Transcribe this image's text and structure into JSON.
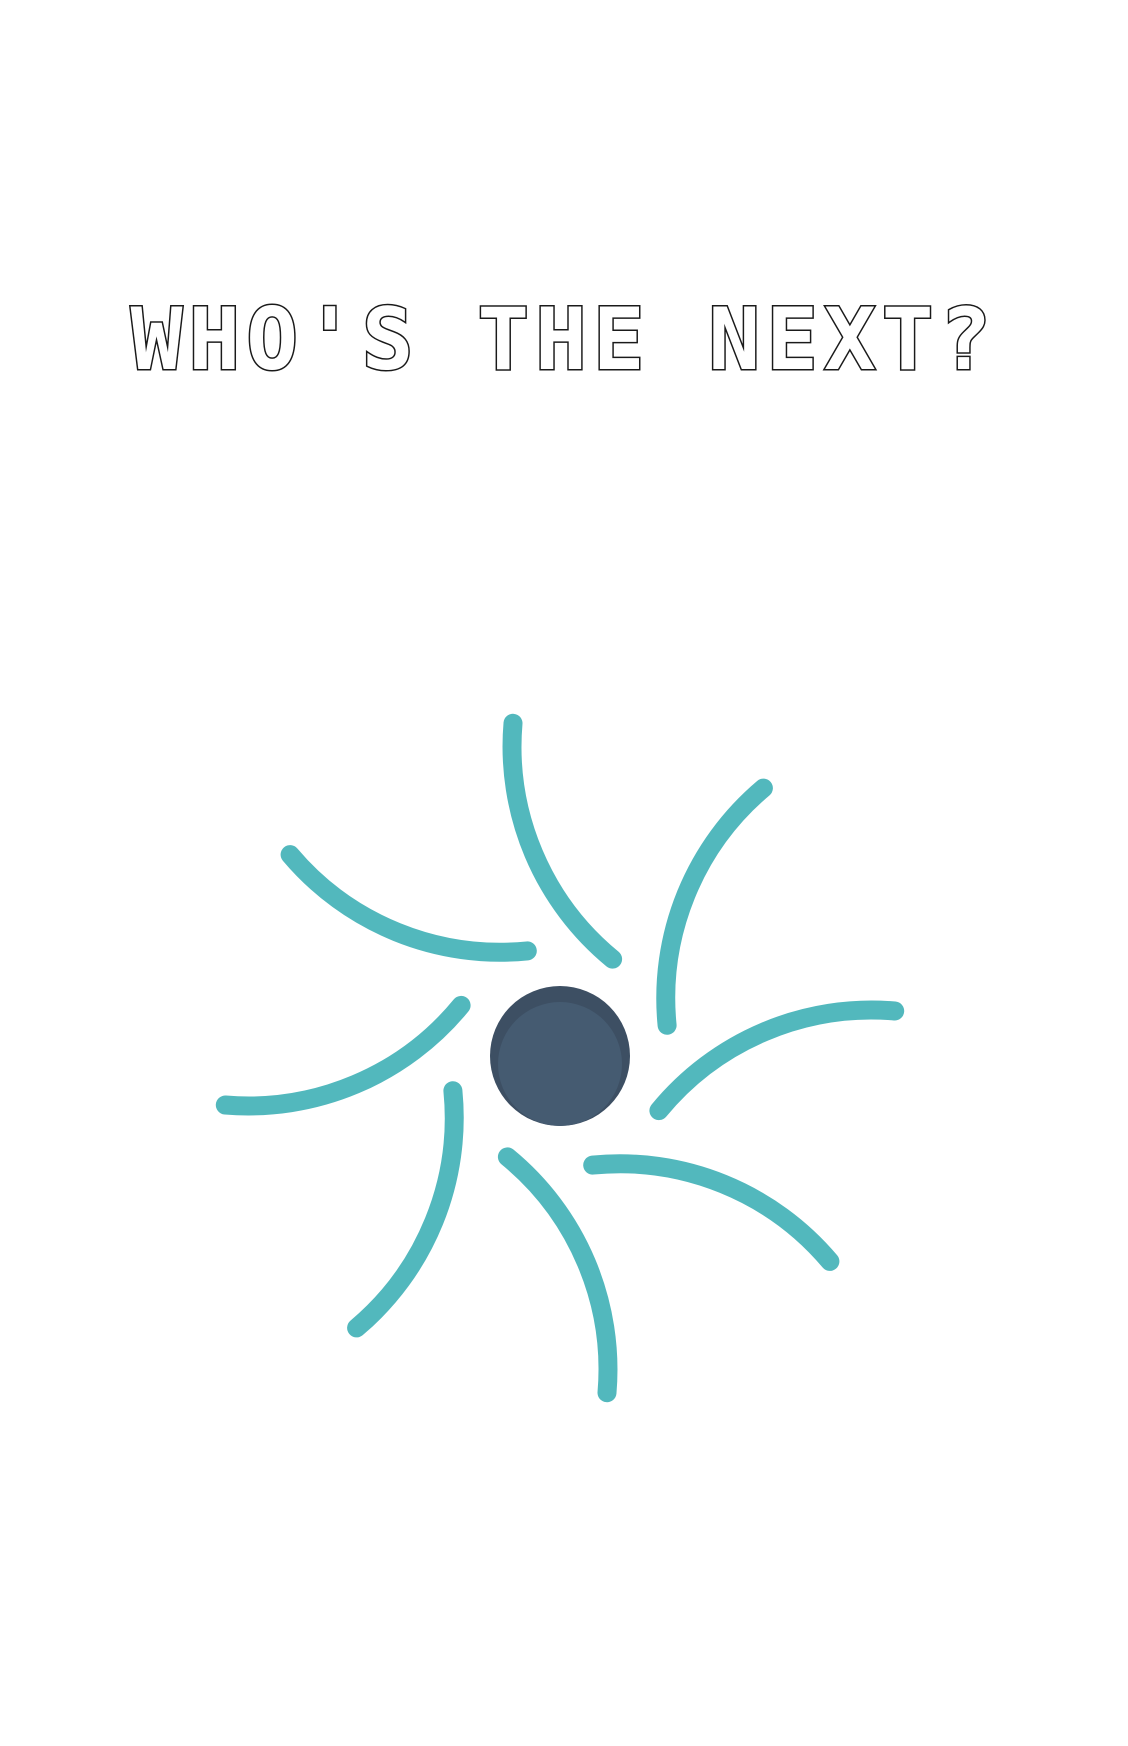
{
  "headline": {
    "text": "WHO'S THE NEXT?"
  },
  "graphic": {
    "icon": "swirl-vortex-icon",
    "arm_count": 8,
    "colors": {
      "arms": "#52b8bd",
      "core": "#455b71",
      "core_shadow": "#3d4f63",
      "headline_outline": "#1a1a1a",
      "background": "#ffffff"
    }
  }
}
